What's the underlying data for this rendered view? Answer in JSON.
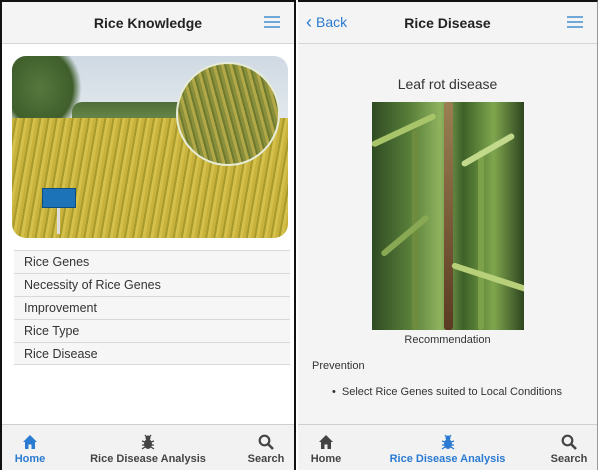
{
  "left": {
    "header": {
      "title": "Rice Knowledge"
    },
    "menu_items": [
      "Rice Genes",
      "Necessity of Rice Genes",
      "Improvement",
      "Rice Type",
      "Rice Disease"
    ],
    "tabs": [
      {
        "label": "Home",
        "icon": "home-icon",
        "active": true
      },
      {
        "label": "Rice Disease Analysis",
        "icon": "bug-icon",
        "active": false
      },
      {
        "label": "Search",
        "icon": "search-icon",
        "active": false
      }
    ]
  },
  "right": {
    "header": {
      "title": "Rice Disease",
      "back_label": "Back"
    },
    "disease_title": "Leaf rot disease",
    "recommendation_label": "Recommendation",
    "prevention_label": "Prevention",
    "prevention_items": [
      "Select Rice Genes suited to Local Conditions"
    ],
    "tabs": [
      {
        "label": "Home",
        "icon": "home-icon",
        "active": false
      },
      {
        "label": "Rice Disease Analysis",
        "icon": "bug-icon",
        "active": true
      },
      {
        "label": "Search",
        "icon": "search-icon",
        "active": false
      }
    ]
  },
  "colors": {
    "accent": "#2a7bd1",
    "tab_icon": "#444444",
    "menu_icon": "#6fa7d8"
  }
}
